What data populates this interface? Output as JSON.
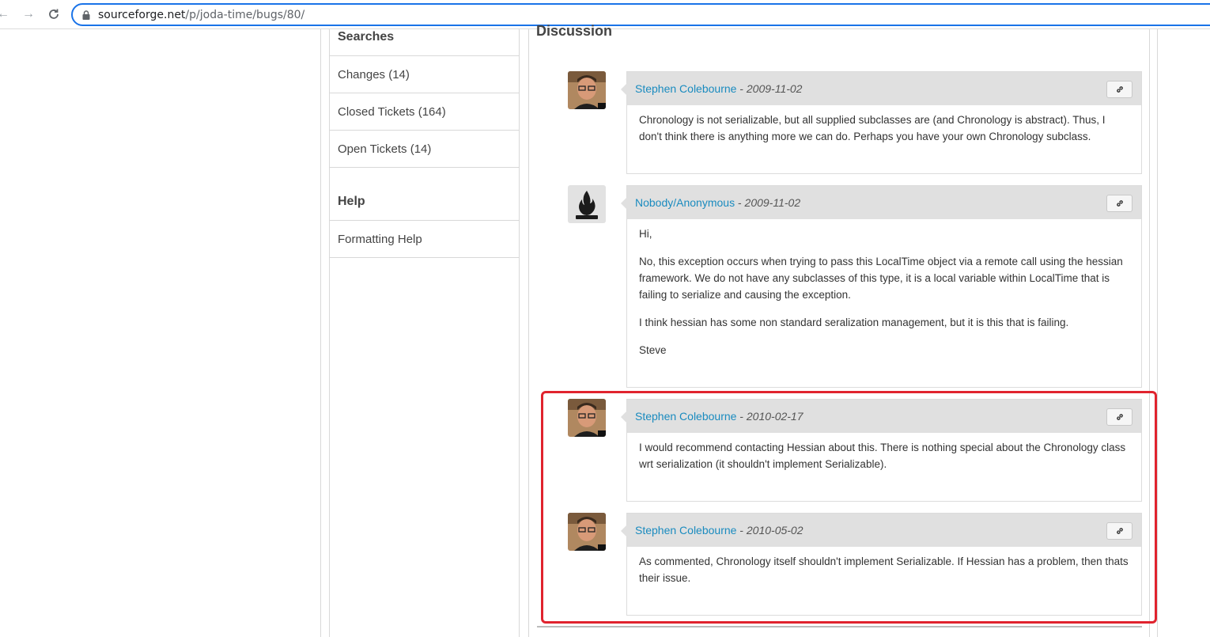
{
  "browser": {
    "url_host": "sourceforge.net",
    "url_path": "/p/joda-time/bugs/80/"
  },
  "sidebar": {
    "searches_heading": "Searches",
    "items": [
      {
        "label": "Changes (14)"
      },
      {
        "label": "Closed Tickets (164)"
      },
      {
        "label": "Open Tickets (14)"
      }
    ],
    "help_heading": "Help",
    "help_items": [
      {
        "label": "Formatting Help"
      }
    ]
  },
  "main": {
    "title": "Discussion",
    "comments": [
      {
        "author": "Stephen Colebourne",
        "separator": "-",
        "date": "2009-11-02",
        "avatar": "stephen-photo",
        "paragraphs": [
          "Chronology is not serializable, but all supplied subclasses are (and Chronology is abstract). Thus, I don't think there is anything more we can do. Perhaps you have your own Chronology subclass."
        ]
      },
      {
        "author": "Nobody/Anonymous",
        "separator": "-",
        "date": "2009-11-02",
        "avatar": "anonymous-flame",
        "paragraphs": [
          "Hi,",
          "No, this exception occurs when trying to pass this LocalTime object via a remote call using the hessian framework. We do not have any subclasses of this type, it is a local variable within LocalTime that is failing to serialize and causing the exception.",
          "I think hessian has some non standard seralization management, but it is this that is failing.",
          "Steve"
        ]
      },
      {
        "author": "Stephen Colebourne",
        "separator": "-",
        "date": "2010-02-17",
        "avatar": "stephen-photo",
        "paragraphs": [
          "I would recommend contacting Hessian about this. There is nothing special about the Chronology class wrt serialization (it shouldn't implement Serializable)."
        ]
      },
      {
        "author": "Stephen Colebourne",
        "separator": "-",
        "date": "2010-05-02",
        "avatar": "stephen-photo",
        "paragraphs": [
          "As commented, Chronology itself shouldn't implement Serializable. If Hessian has a problem, then thats their issue."
        ]
      }
    ]
  },
  "colors": {
    "link": "#1a8bbf",
    "header_bg": "#e0e0e0",
    "highlight": "#e0232e",
    "focus": "#1a73e8"
  }
}
